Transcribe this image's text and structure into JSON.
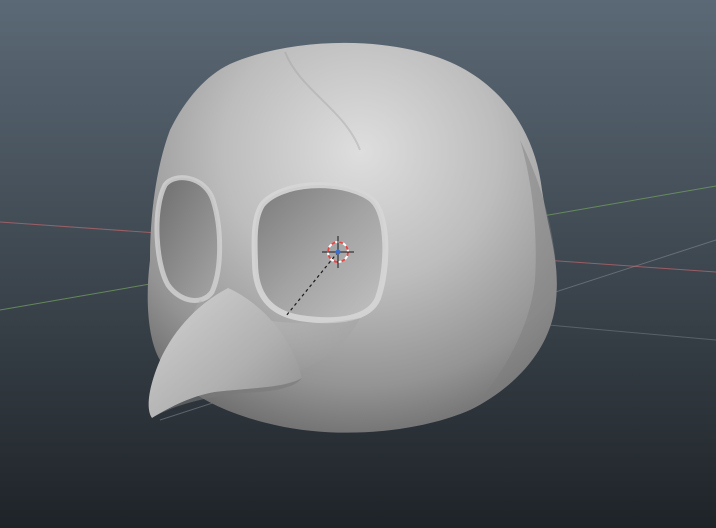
{
  "viewport": {
    "name": "3D viewport",
    "background_top": "#5a6874",
    "background_bottom": "#1f2429"
  },
  "axes": {
    "x_axis_color": "#c86a70",
    "y_axis_color": "#7aa868",
    "grid_color": "#8e969d"
  },
  "model": {
    "description_icon": "bird-head-mesh",
    "surface_color": "#b4b4b4",
    "highlight_color": "#e2e2e2",
    "shadow_color": "#6c6c6c",
    "cavity_color": "#5a5a5a"
  },
  "cursor": {
    "icon": "3d-cursor-icon",
    "ring_color_a": "#e04848",
    "ring_color_b": "#ffffff",
    "center_color": "#3a6fd0"
  }
}
